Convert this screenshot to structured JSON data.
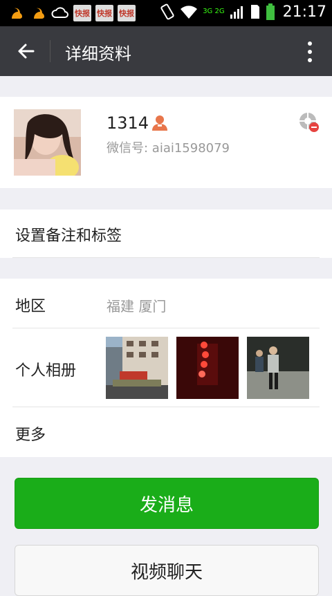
{
  "statusbar": {
    "time": "21:17",
    "network": "3G 2G",
    "news_label": "快报"
  },
  "toolbar": {
    "title": "详细资料"
  },
  "profile": {
    "name": "1314",
    "wechat_id": "微信号: aiai1598079"
  },
  "rows": {
    "note_label": "设置备注和标签",
    "region_label": "地区",
    "region_value": "福建  厦门",
    "album_label": "个人相册",
    "more_label": "更多"
  },
  "buttons": {
    "send_message": "发消息",
    "video_chat": "视频聊天"
  },
  "colors": {
    "toolbar": "#393a3f",
    "primary_green": "#1aad19",
    "background": "#efeff4"
  }
}
